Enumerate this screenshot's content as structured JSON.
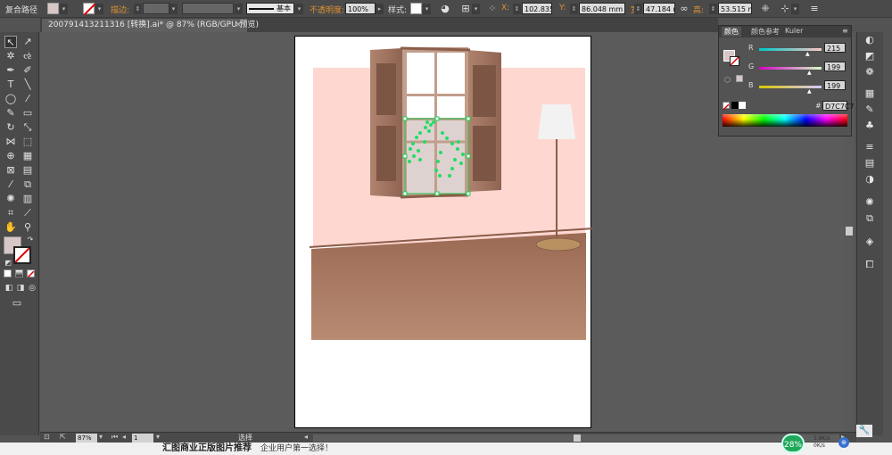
{
  "control_bar": {
    "object_type": "复合路径",
    "stroke_label": "描边:",
    "stroke_profile": "基本",
    "opacity_label": "不透明度:",
    "opacity_value": "100%",
    "style_label": "样式:",
    "x_label": "X:",
    "x_value": "102.835",
    "y_label": "Y:",
    "y_value": "86.048 mm",
    "w_label": "宽:",
    "w_value": "47.184 m",
    "h_label": "高:",
    "h_value": "53.515 mm",
    "fill_color": "#d7c7c7"
  },
  "document_tab": {
    "title": "200791413211316 [转换].ai* @ 87% (RGB/GPU 预览)",
    "close_glyph": "×"
  },
  "color_panel": {
    "tabs": [
      "颜色",
      "颜色参考",
      "Kuler"
    ],
    "r_label": "R",
    "r_value": "215",
    "g_label": "G",
    "g_value": "199",
    "b_label": "B",
    "b_value": "199",
    "hex_prefix": "#",
    "hex_value": "D7C7C7"
  },
  "status_bar": {
    "zoom": "87%",
    "page": "1",
    "tool": "选择"
  },
  "banner": {
    "headline": "汇图商业正版图片推荐",
    "subline": "企业用户第一选择！"
  },
  "system": {
    "badge_percent": "28%",
    "net_up": "3.8K/s",
    "net_down": "0K/s"
  },
  "colors": {
    "wall": "#ffd7d1",
    "floor_top": "#9b6a54",
    "floor_bottom": "#b98b73",
    "shutter": "#a07762",
    "window_glass": "#ddd2d0",
    "selection": "#22cc55"
  }
}
